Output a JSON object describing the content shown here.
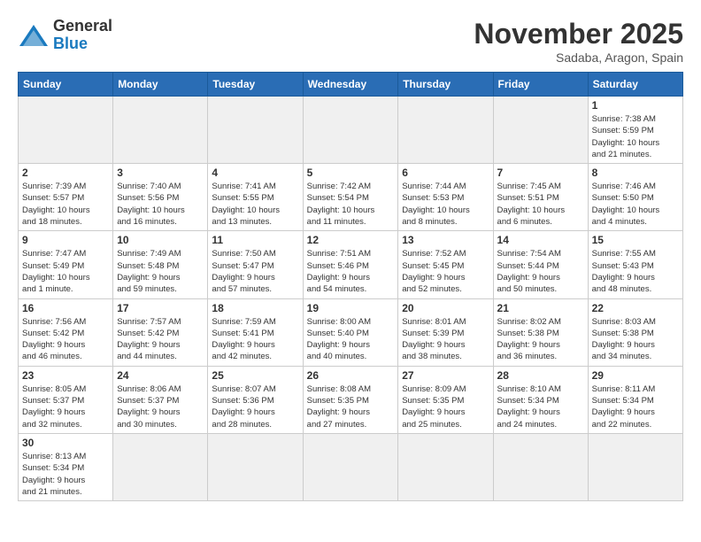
{
  "header": {
    "logo_general": "General",
    "logo_blue": "Blue",
    "title": "November 2025",
    "subtitle": "Sadaba, Aragon, Spain"
  },
  "weekdays": [
    "Sunday",
    "Monday",
    "Tuesday",
    "Wednesday",
    "Thursday",
    "Friday",
    "Saturday"
  ],
  "weeks": [
    [
      {
        "day": "",
        "info": ""
      },
      {
        "day": "",
        "info": ""
      },
      {
        "day": "",
        "info": ""
      },
      {
        "day": "",
        "info": ""
      },
      {
        "day": "",
        "info": ""
      },
      {
        "day": "",
        "info": ""
      },
      {
        "day": "1",
        "info": "Sunrise: 7:38 AM\nSunset: 5:59 PM\nDaylight: 10 hours\nand 21 minutes."
      }
    ],
    [
      {
        "day": "2",
        "info": "Sunrise: 7:39 AM\nSunset: 5:57 PM\nDaylight: 10 hours\nand 18 minutes."
      },
      {
        "day": "3",
        "info": "Sunrise: 7:40 AM\nSunset: 5:56 PM\nDaylight: 10 hours\nand 16 minutes."
      },
      {
        "day": "4",
        "info": "Sunrise: 7:41 AM\nSunset: 5:55 PM\nDaylight: 10 hours\nand 13 minutes."
      },
      {
        "day": "5",
        "info": "Sunrise: 7:42 AM\nSunset: 5:54 PM\nDaylight: 10 hours\nand 11 minutes."
      },
      {
        "day": "6",
        "info": "Sunrise: 7:44 AM\nSunset: 5:53 PM\nDaylight: 10 hours\nand 8 minutes."
      },
      {
        "day": "7",
        "info": "Sunrise: 7:45 AM\nSunset: 5:51 PM\nDaylight: 10 hours\nand 6 minutes."
      },
      {
        "day": "8",
        "info": "Sunrise: 7:46 AM\nSunset: 5:50 PM\nDaylight: 10 hours\nand 4 minutes."
      }
    ],
    [
      {
        "day": "9",
        "info": "Sunrise: 7:47 AM\nSunset: 5:49 PM\nDaylight: 10 hours\nand 1 minute."
      },
      {
        "day": "10",
        "info": "Sunrise: 7:49 AM\nSunset: 5:48 PM\nDaylight: 9 hours\nand 59 minutes."
      },
      {
        "day": "11",
        "info": "Sunrise: 7:50 AM\nSunset: 5:47 PM\nDaylight: 9 hours\nand 57 minutes."
      },
      {
        "day": "12",
        "info": "Sunrise: 7:51 AM\nSunset: 5:46 PM\nDaylight: 9 hours\nand 54 minutes."
      },
      {
        "day": "13",
        "info": "Sunrise: 7:52 AM\nSunset: 5:45 PM\nDaylight: 9 hours\nand 52 minutes."
      },
      {
        "day": "14",
        "info": "Sunrise: 7:54 AM\nSunset: 5:44 PM\nDaylight: 9 hours\nand 50 minutes."
      },
      {
        "day": "15",
        "info": "Sunrise: 7:55 AM\nSunset: 5:43 PM\nDaylight: 9 hours\nand 48 minutes."
      }
    ],
    [
      {
        "day": "16",
        "info": "Sunrise: 7:56 AM\nSunset: 5:42 PM\nDaylight: 9 hours\nand 46 minutes."
      },
      {
        "day": "17",
        "info": "Sunrise: 7:57 AM\nSunset: 5:42 PM\nDaylight: 9 hours\nand 44 minutes."
      },
      {
        "day": "18",
        "info": "Sunrise: 7:59 AM\nSunset: 5:41 PM\nDaylight: 9 hours\nand 42 minutes."
      },
      {
        "day": "19",
        "info": "Sunrise: 8:00 AM\nSunset: 5:40 PM\nDaylight: 9 hours\nand 40 minutes."
      },
      {
        "day": "20",
        "info": "Sunrise: 8:01 AM\nSunset: 5:39 PM\nDaylight: 9 hours\nand 38 minutes."
      },
      {
        "day": "21",
        "info": "Sunrise: 8:02 AM\nSunset: 5:38 PM\nDaylight: 9 hours\nand 36 minutes."
      },
      {
        "day": "22",
        "info": "Sunrise: 8:03 AM\nSunset: 5:38 PM\nDaylight: 9 hours\nand 34 minutes."
      }
    ],
    [
      {
        "day": "23",
        "info": "Sunrise: 8:05 AM\nSunset: 5:37 PM\nDaylight: 9 hours\nand 32 minutes."
      },
      {
        "day": "24",
        "info": "Sunrise: 8:06 AM\nSunset: 5:37 PM\nDaylight: 9 hours\nand 30 minutes."
      },
      {
        "day": "25",
        "info": "Sunrise: 8:07 AM\nSunset: 5:36 PM\nDaylight: 9 hours\nand 28 minutes."
      },
      {
        "day": "26",
        "info": "Sunrise: 8:08 AM\nSunset: 5:35 PM\nDaylight: 9 hours\nand 27 minutes."
      },
      {
        "day": "27",
        "info": "Sunrise: 8:09 AM\nSunset: 5:35 PM\nDaylight: 9 hours\nand 25 minutes."
      },
      {
        "day": "28",
        "info": "Sunrise: 8:10 AM\nSunset: 5:34 PM\nDaylight: 9 hours\nand 24 minutes."
      },
      {
        "day": "29",
        "info": "Sunrise: 8:11 AM\nSunset: 5:34 PM\nDaylight: 9 hours\nand 22 minutes."
      }
    ],
    [
      {
        "day": "30",
        "info": "Sunrise: 8:13 AM\nSunset: 5:34 PM\nDaylight: 9 hours\nand 21 minutes."
      },
      {
        "day": "",
        "info": ""
      },
      {
        "day": "",
        "info": ""
      },
      {
        "day": "",
        "info": ""
      },
      {
        "day": "",
        "info": ""
      },
      {
        "day": "",
        "info": ""
      },
      {
        "day": "",
        "info": ""
      }
    ]
  ]
}
